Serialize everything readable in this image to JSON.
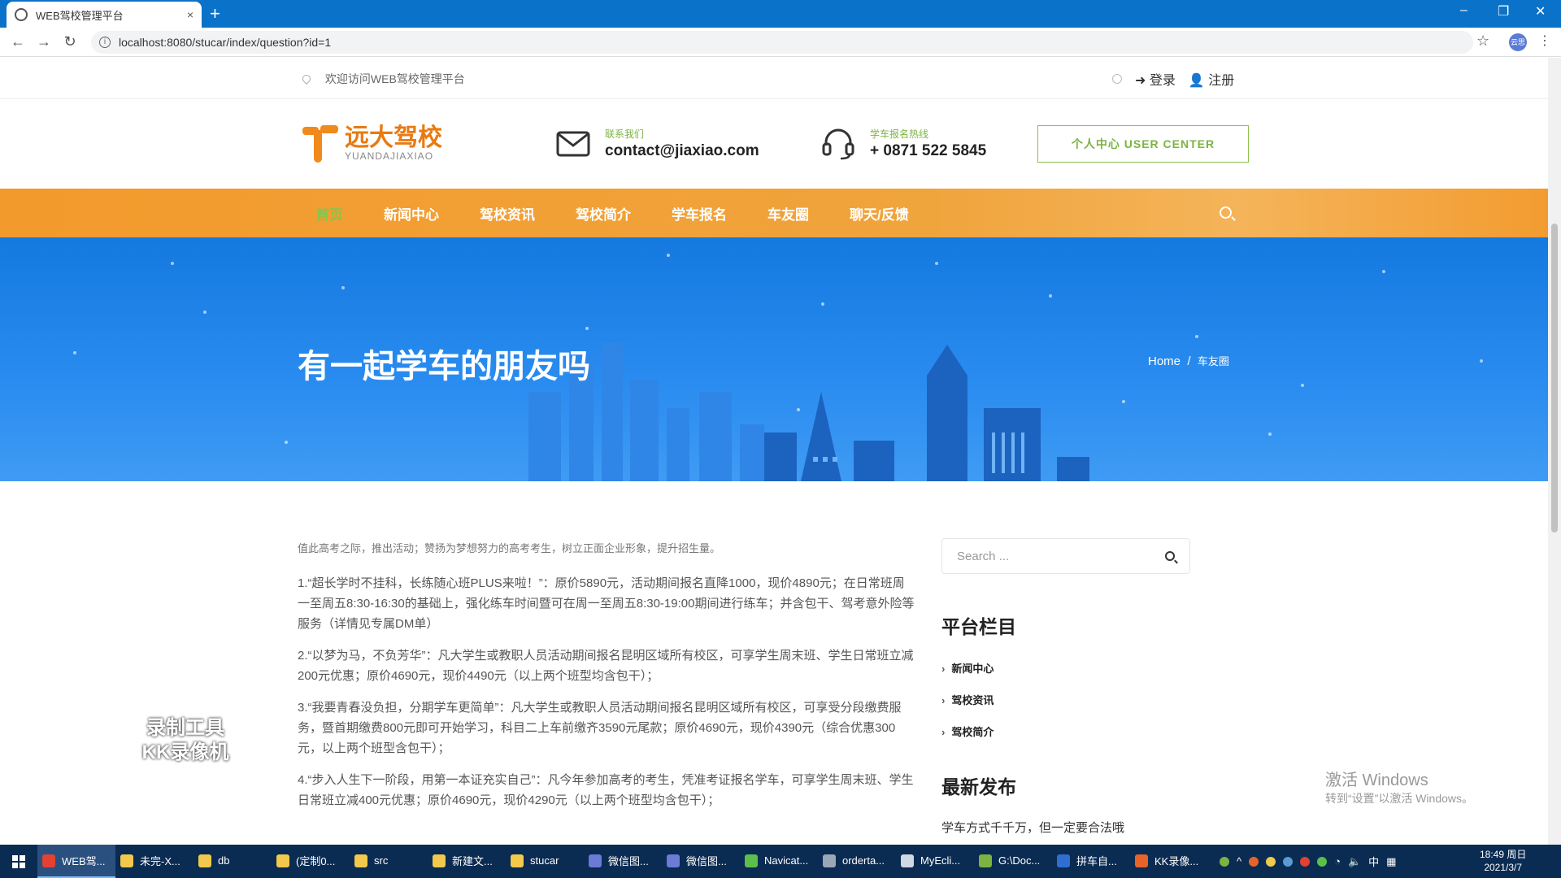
{
  "browser": {
    "tab_title": "WEB驾校管理平台",
    "tab_close": "×",
    "new_tab": "+",
    "url": "localhost:8080/stucar/index/question?id=1",
    "profile_badge": "云思",
    "win_min": "–",
    "win_restore": "❐",
    "win_close": "✕"
  },
  "topbar": {
    "welcome": "欢迎访问WEB驾校管理平台",
    "login": "登录",
    "register": "注册"
  },
  "header": {
    "logo_cn": "远大驾校",
    "logo_en": "YUANDAJIAXIAO",
    "contact_label": "联系我们",
    "contact_value": "contact@jiaxiao.com",
    "hotline_label": "学车报名热线",
    "hotline_value": "+ 0871 522 5845",
    "user_center": "个人中心 USER CENTER"
  },
  "nav": {
    "items": [
      "首页",
      "新闻中心",
      "驾校资讯",
      "驾校简介",
      "学车报名",
      "车友圈",
      "聊天/反馈"
    ],
    "active_index": 0
  },
  "banner": {
    "title": "有一起学车的朋友吗",
    "crumb_home": "Home",
    "crumb_sep": "/",
    "crumb_current": "车友圈"
  },
  "article": {
    "lead": "值此高考之际，推出活动；赞扬为梦想努力的高考考生，树立正面企业形象，提升招生量。",
    "paragraphs": [
      "1.“超长学时不挂科，长练随心班PLUS来啦！”：原价5890元，活动期间报名直降1000，现价4890元；在日常班周一至周五8:30-16:30的基础上，强化练车时间暨可在周一至周五8:30-19:00期间进行练车；并含包干、驾考意外险等服务（详情见专属DM单）",
      "2.“以梦为马，不负芳华”：凡大学生或教职人员活动期间报名昆明区域所有校区，可享学生周末班、学生日常班立减200元优惠；原价4690元，现价4490元（以上两个班型均含包干）；",
      "3.“我要青春没负担，分期学车更简单”：凡大学生或教职人员活动期间报名昆明区域所有校区，可享受分段缴费服务，暨首期缴费800元即可开始学习，科目二上车前缴齐3590元尾款；原价4690元，现价4390元（综合优惠300元，以上两个班型含包干）；",
      "4.“步入人生下一阶段，用第一本证充实自己”：凡今年参加高考的考生，凭准考证报名学车，可享学生周末班、学生日常班立减400元优惠；原价4690元，现价4290元（以上两个班型均含包干）；"
    ]
  },
  "sidebar": {
    "search_placeholder": "Search ...",
    "columns_title": "平台栏目",
    "columns": [
      "新闻中心",
      "驾校资讯",
      "驾校简介"
    ],
    "recent_title": "最新发布",
    "recent_first": "学车方式千千万，但一定要合法哦"
  },
  "overlay": {
    "watermark_line1": "录制工具",
    "watermark_line2": "KK录像机",
    "activate_1": "激活 Windows",
    "activate_2": "转到“设置”以激活 Windows。"
  },
  "taskbar": {
    "items": [
      {
        "label": "WEB驾...",
        "color": "#e34133"
      },
      {
        "label": "未完-X...",
        "color": "#f2c94c"
      },
      {
        "label": "db",
        "color": "#f2c94c"
      },
      {
        "label": "(定制0...",
        "color": "#f2c94c"
      },
      {
        "label": "src",
        "color": "#f2c94c"
      },
      {
        "label": "新建文...",
        "color": "#f2c94c"
      },
      {
        "label": "stucar",
        "color": "#f2c94c"
      },
      {
        "label": "微信图...",
        "color": "#6b7bd6"
      },
      {
        "label": "微信图...",
        "color": "#6b7bd6"
      },
      {
        "label": "Navicat...",
        "color": "#5cbf4c"
      },
      {
        "label": "orderta...",
        "color": "#9aa7b6"
      },
      {
        "label": "MyEcli...",
        "color": "#cfd8e3"
      },
      {
        "label": "G:\\Doc...",
        "color": "#7cb342"
      },
      {
        "label": "拼车自...",
        "color": "#2f6fd1"
      },
      {
        "label": "KK录像...",
        "color": "#e8632a"
      }
    ],
    "ime": "中",
    "time": "18:49 周日",
    "date": "2021/3/7"
  }
}
